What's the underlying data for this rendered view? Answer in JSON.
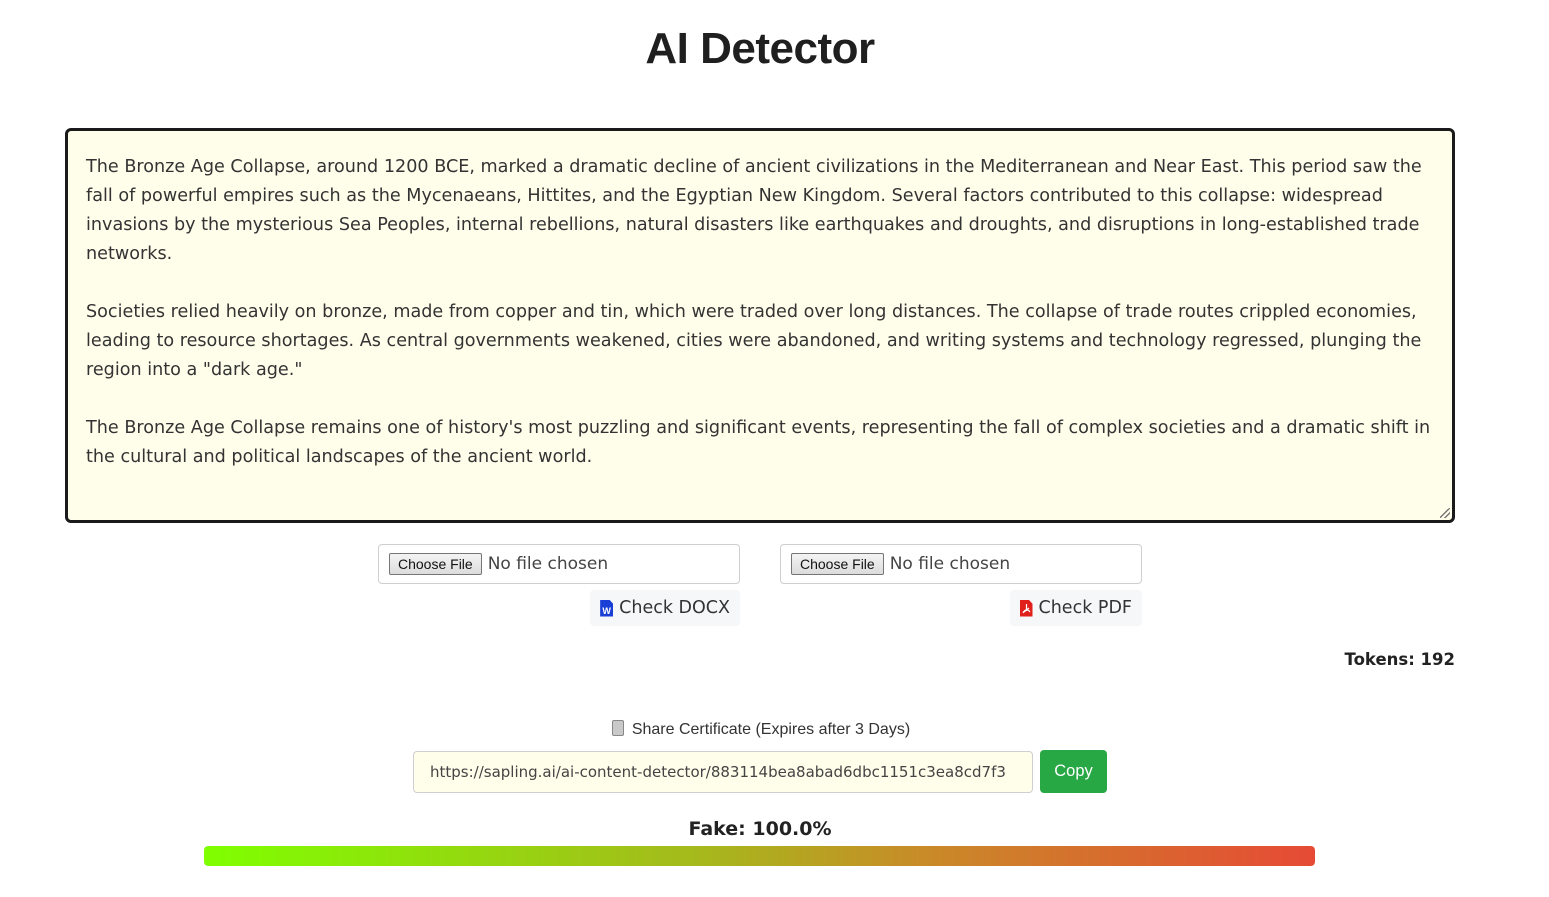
{
  "title": "AI Detector",
  "editor": {
    "paragraphs": [
      "The Bronze Age Collapse, around 1200 BCE, marked a dramatic decline of ancient civilizations in the Mediterranean and Near East. This period saw the fall of powerful empires such as the Mycenaeans, Hittites, and the Egyptian New Kingdom. Several factors contributed to this collapse: widespread invasions by the mysterious Sea Peoples, internal rebellions, natural disasters like earthquakes and droughts, and disruptions in long-established trade networks.",
      "Societies relied heavily on bronze, made from copper and tin, which were traded over long distances. The collapse of trade routes crippled economies, leading to resource shortages. As central governments weakened, cities were abandoned, and writing systems and technology regressed, plunging the region into a \"dark age.\"",
      "The Bronze Age Collapse remains one of history's most puzzling and significant events, representing the fall of complex societies and a dramatic shift in the cultural and political landscapes of the ancient world."
    ]
  },
  "file_docx": {
    "choose_label": "Choose File",
    "status": "No file chosen",
    "check_label": "Check DOCX",
    "icon": "word-doc-icon",
    "icon_letter": "W",
    "icon_color": "#1a3fd6"
  },
  "file_pdf": {
    "choose_label": "Choose File",
    "status": "No file chosen",
    "check_label": "Check PDF",
    "icon": "pdf-doc-icon",
    "icon_letter": "",
    "icon_color": "#e0201b"
  },
  "tokens_label": "Tokens: 192",
  "share": {
    "label": "Share Certificate (Expires after 3 Days)",
    "icon": "scroll-icon",
    "url": "https://sapling.ai/ai-content-detector/883114bea8abad6dbc1151c3ea8cd7f3",
    "copy_label": "Copy",
    "copy_color": "#28a745"
  },
  "result": {
    "label": "Fake: 100.0%",
    "fake_fraction": 1.0
  }
}
